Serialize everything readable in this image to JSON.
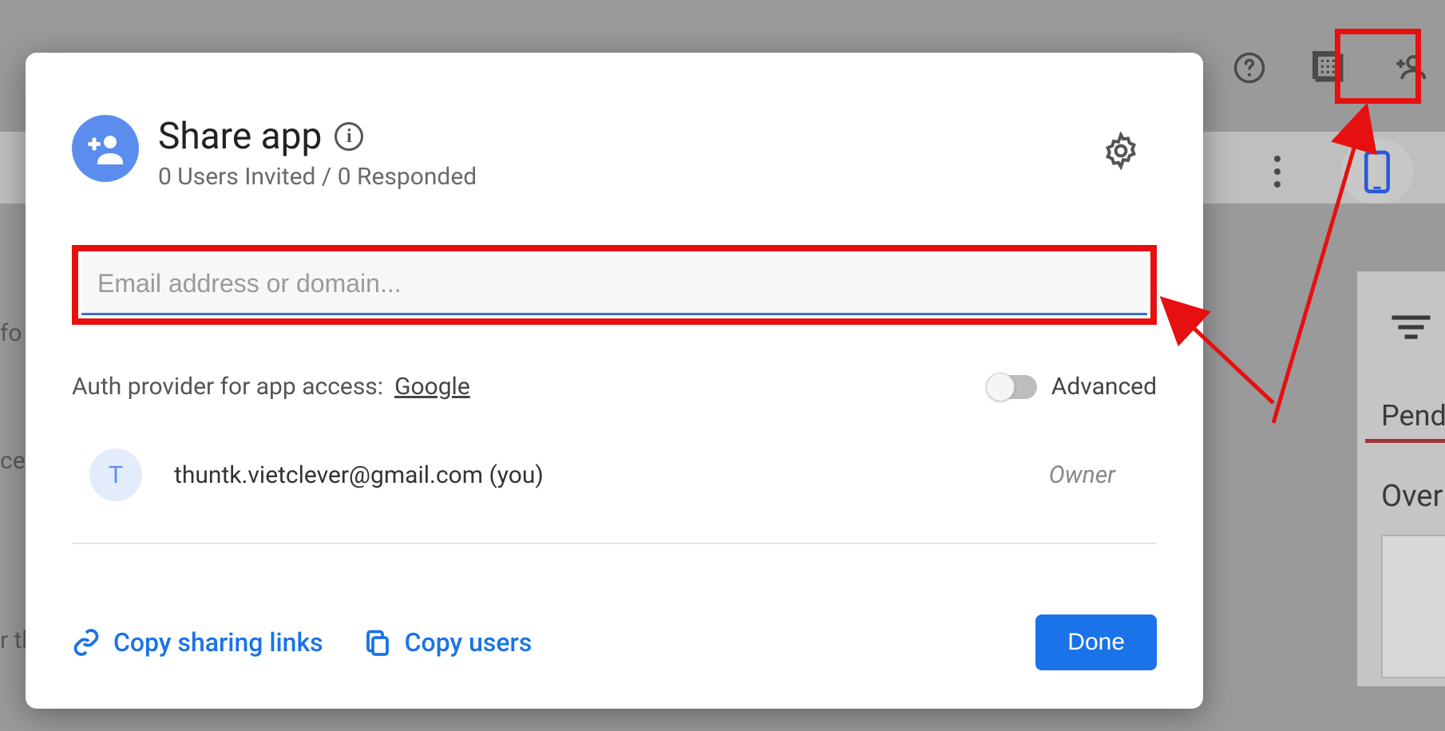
{
  "header": {
    "title": "Share app",
    "subtitle": "0 Users Invited / 0 Responded"
  },
  "email_input": {
    "placeholder": "Email address or domain..."
  },
  "auth": {
    "label": "Auth provider for app access:",
    "provider": "Google",
    "advanced_label": "Advanced"
  },
  "users": [
    {
      "avatar_letter": "T",
      "email": "thuntk.vietclever@gmail.com (you)",
      "role": "Owner"
    }
  ],
  "footer": {
    "copy_links": "Copy sharing links",
    "copy_users": "Copy users",
    "done": "Done"
  },
  "bg": {
    "left_text_1": "fo",
    "left_text_2": "ce",
    "left_text_3": "r th",
    "pending": "Pendi",
    "overview": "Over"
  }
}
